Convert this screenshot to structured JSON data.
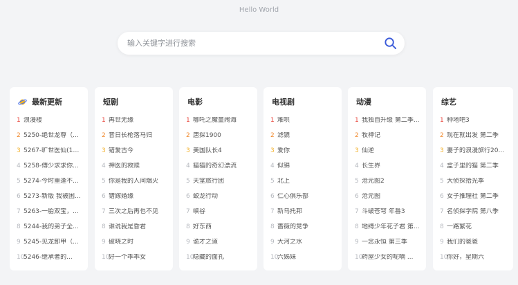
{
  "header": {
    "title": "Hello World"
  },
  "search": {
    "placeholder": "输入关键字进行搜索",
    "value": ""
  },
  "colors": {
    "rank1": "#e8453c",
    "rank2": "#f08a2e",
    "rank3": "#f2b12c",
    "accent": "#3b5bd9"
  },
  "cards": [
    {
      "title": "最新更新",
      "icon": "planet-icon",
      "items": [
        {
          "n": "1",
          "t": "浪漫楼"
        },
        {
          "n": "2",
          "t": "5250-绝世龙尊（..."
        },
        {
          "n": "3",
          "t": "5267-旷世医仙(10..."
        },
        {
          "n": "4",
          "t": "5258-傅少求求你..."
        },
        {
          "n": "5",
          "t": "5274-今时重逢不..."
        },
        {
          "n": "6",
          "t": "5273-新版 我被困..."
        },
        {
          "n": "7",
          "t": "5263-一胎双宝，..."
        },
        {
          "n": "8",
          "t": "5244-我的弟子全..."
        },
        {
          "n": "9",
          "t": "5245-见龙卸甲（..."
        },
        {
          "n": "10",
          "t": "5246-继承者的..."
        }
      ]
    },
    {
      "title": "短剧",
      "items": [
        {
          "n": "1",
          "t": "再世无缘"
        },
        {
          "n": "2",
          "t": "昔日长枪落马归"
        },
        {
          "n": "3",
          "t": "错爱古今"
        },
        {
          "n": "4",
          "t": "神医的救赎"
        },
        {
          "n": "5",
          "t": "你是我的人间烟火"
        },
        {
          "n": "6",
          "t": "错嫁婚缘"
        },
        {
          "n": "7",
          "t": "三次之后再也不见"
        },
        {
          "n": "8",
          "t": "谁说我是昏君"
        },
        {
          "n": "9",
          "t": "破晓之时"
        },
        {
          "n": "10",
          "t": "好一个乖乖女"
        }
      ]
    },
    {
      "title": "电影",
      "items": [
        {
          "n": "1",
          "t": "哪吒之魔童闹海"
        },
        {
          "n": "2",
          "t": "唐探1900"
        },
        {
          "n": "3",
          "t": "美国队长4"
        },
        {
          "n": "4",
          "t": "猫猫的奇幻漂流"
        },
        {
          "n": "5",
          "t": "天堂旅行团"
        },
        {
          "n": "6",
          "t": "蛟龙行动"
        },
        {
          "n": "7",
          "t": "峡谷"
        },
        {
          "n": "8",
          "t": "好东西"
        },
        {
          "n": "9",
          "t": "诡才之道"
        },
        {
          "n": "10",
          "t": "隐藏的面孔"
        }
      ]
    },
    {
      "title": "电视剧",
      "items": [
        {
          "n": "1",
          "t": "难哄"
        },
        {
          "n": "2",
          "t": "滤镜"
        },
        {
          "n": "3",
          "t": "爱你"
        },
        {
          "n": "4",
          "t": "似锦"
        },
        {
          "n": "5",
          "t": "北上"
        },
        {
          "n": "6",
          "t": "仁心俱乐部"
        },
        {
          "n": "7",
          "t": "新乌托邦"
        },
        {
          "n": "8",
          "t": "蔷薇的竞争"
        },
        {
          "n": "9",
          "t": "大河之水"
        },
        {
          "n": "10",
          "t": "六姊妹"
        }
      ]
    },
    {
      "title": "动漫",
      "items": [
        {
          "n": "1",
          "t": "我独自升级 第二季..."
        },
        {
          "n": "2",
          "t": "牧神记"
        },
        {
          "n": "3",
          "t": "仙逆"
        },
        {
          "n": "4",
          "t": "长生界"
        },
        {
          "n": "5",
          "t": "沧元图2"
        },
        {
          "n": "6",
          "t": "沧元图"
        },
        {
          "n": "7",
          "t": "斗破苍穹 年番3"
        },
        {
          "n": "8",
          "t": "地缚少年花子君 第..."
        },
        {
          "n": "9",
          "t": "一念永恒 第三季"
        },
        {
          "n": "10",
          "t": "药屋少女的呢喃 ..."
        }
      ]
    },
    {
      "title": "综艺",
      "items": [
        {
          "n": "1",
          "t": "种地吧3"
        },
        {
          "n": "2",
          "t": "现在就出发 第二季"
        },
        {
          "n": "3",
          "t": "妻子的浪漫旅行20..."
        },
        {
          "n": "4",
          "t": "盒子里的猫 第二季"
        },
        {
          "n": "5",
          "t": "大侦探拾光季"
        },
        {
          "n": "6",
          "t": "女子推理社 第二季"
        },
        {
          "n": "7",
          "t": "名侦探学院 第八季"
        },
        {
          "n": "8",
          "t": "一路繁花"
        },
        {
          "n": "9",
          "t": "我们的爸爸"
        },
        {
          "n": "10",
          "t": "你好，星期六"
        }
      ]
    }
  ]
}
